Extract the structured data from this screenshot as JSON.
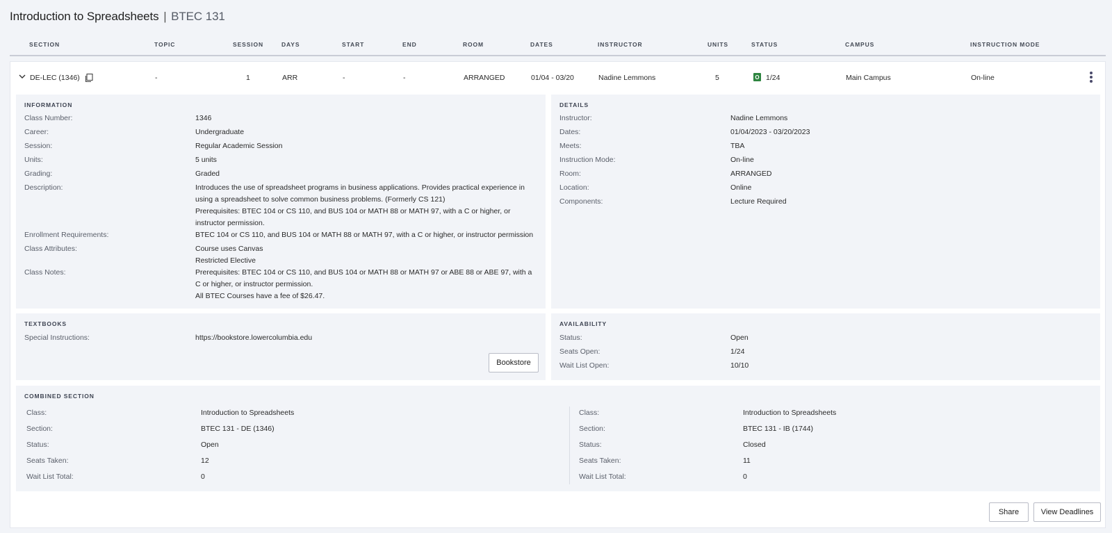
{
  "page": {
    "title": "Introduction to Spreadsheets",
    "separator": "|",
    "code": "BTEC 131"
  },
  "columns": [
    "SECTION",
    "TOPIC",
    "SESSION",
    "DAYS",
    "START",
    "END",
    "ROOM",
    "DATES",
    "INSTRUCTOR",
    "UNITS",
    "STATUS",
    "CAMPUS",
    "INSTRUCTION MODE"
  ],
  "row": {
    "section": "DE-LEC (1346)",
    "topic": "-",
    "session": "1",
    "days": "ARR",
    "start": "-",
    "end": "-",
    "room": "ARRANGED",
    "dates": "01/04 - 03/20",
    "instructor": "Nadine Lemmons",
    "units": "5",
    "status_badge": "O",
    "status": "1/24",
    "campus": "Main Campus",
    "mode": "On-line"
  },
  "information": {
    "title": "INFORMATION",
    "class_number_label": "Class Number:",
    "class_number": "1346",
    "career_label": "Career:",
    "career": "Undergraduate",
    "session_label": "Session:",
    "session": "Regular Academic Session",
    "units_label": "Units:",
    "units": "5 units",
    "grading_label": "Grading:",
    "grading": "Graded",
    "description_label": "Description:",
    "description_l1": "Introduces the use of spreadsheet programs in business applications. Provides practical experience in",
    "description_l2": "using a spreadsheet to solve common business problems. (Formerly CS 121)",
    "description_l3": "Prerequisites: BTEC 104 or CS 110, and BUS 104 or MATH 88 or MATH 97, with a C or higher, or",
    "description_l4": "instructor permission.",
    "enroll_label": "Enrollment Requirements:",
    "enroll": "BTEC 104 or CS 110, and BUS 104 or MATH 88 or MATH 97, with a C or higher, or instructor permission",
    "attributes_label": "Class Attributes:",
    "attribute_1": "Course uses Canvas",
    "attribute_2": "Restricted Elective",
    "notes_label": "Class Notes:",
    "notes_l1": "Prerequisites: BTEC 104 or CS 110, and BUS 104 or MATH 88 or MATH 97 or ABE 88 or ABE 97, with a",
    "notes_l2": "C or higher, or instructor permission.",
    "notes_l3": "All BTEC Courses have a fee of $26.47."
  },
  "details": {
    "title": "DETAILS",
    "instructor_label": "Instructor:",
    "instructor": "Nadine Lemmons",
    "dates_label": "Dates:",
    "dates": "01/04/2023 - 03/20/2023",
    "meets_label": "Meets:",
    "meets": "TBA",
    "mode_label": "Instruction Mode:",
    "mode": "On-line",
    "room_label": "Room:",
    "room": "ARRANGED",
    "location_label": "Location:",
    "location": "Online",
    "components_label": "Components:",
    "components": "Lecture Required"
  },
  "textbooks": {
    "title": "TEXTBOOKS",
    "special_label": "Special Instructions:",
    "special": "https://bookstore.lowercolumbia.edu",
    "bookstore_button": "Bookstore"
  },
  "availability": {
    "title": "AVAILABILITY",
    "status_label": "Status:",
    "status": "Open",
    "seats_label": "Seats Open:",
    "seats": "1/24",
    "waitlist_label": "Wait List Open:",
    "waitlist": "10/10"
  },
  "combined": {
    "title": "COMBINED SECTION",
    "left": {
      "class_label": "Class:",
      "class": "Introduction to Spreadsheets",
      "section_label": "Section:",
      "section": "BTEC 131 - DE (1346)",
      "status_label": "Status:",
      "status": "Open",
      "taken_label": "Seats Taken:",
      "taken": "12",
      "wl_label": "Wait List Total:",
      "wl": "0"
    },
    "right": {
      "class_label": "Class:",
      "class": "Introduction to Spreadsheets",
      "section_label": "Section:",
      "section": "BTEC 131 - IB (1744)",
      "status_label": "Status:",
      "status": "Closed",
      "taken_label": "Seats Taken:",
      "taken": "11",
      "wl_label": "Wait List Total:",
      "wl": "0"
    }
  },
  "footer": {
    "share_button": "Share",
    "deadlines_button": "View Deadlines"
  },
  "icons": {
    "expand": "chevron-down-icon",
    "copy": "copy-icon",
    "menu": "kebab-menu-icon"
  },
  "colors": {
    "status_open": "#2e8540",
    "panel_bg": "#f2f4f8"
  }
}
